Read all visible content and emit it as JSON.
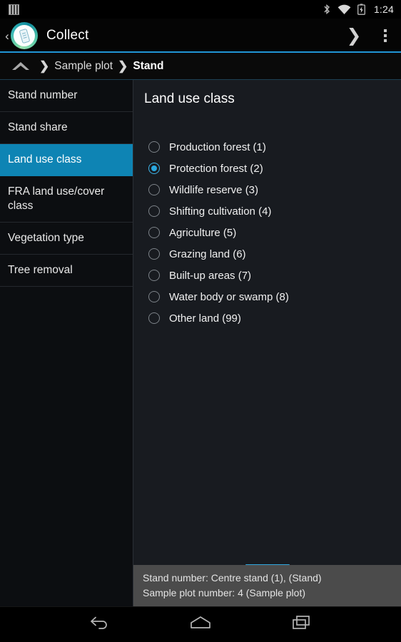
{
  "status_bar": {
    "sim_icon": "sim-card-icon",
    "bluetooth_icon": "bluetooth-icon",
    "wifi_icon": "wifi-icon",
    "battery_icon": "battery-charging-icon",
    "clock": "1:24"
  },
  "app_bar": {
    "up_caret": "‹",
    "logo_icon": "collect-mobile-logo",
    "title": "Collect",
    "next_icon": "chevron-right-icon",
    "overflow_icon": "overflow-menu-icon"
  },
  "breadcrumb": {
    "home_icon": "home-icon",
    "separator": "❯",
    "items": [
      {
        "label": "Sample plot",
        "current": false
      },
      {
        "label": "Stand",
        "current": true
      }
    ]
  },
  "sidebar": {
    "items": [
      {
        "label": "Stand number",
        "selected": false
      },
      {
        "label": "Stand share",
        "selected": false
      },
      {
        "label": "Land use class",
        "selected": true
      },
      {
        "label": "FRA land use/cover class",
        "selected": false
      },
      {
        "label": "Vegetation type",
        "selected": false
      },
      {
        "label": "Tree removal",
        "selected": false
      }
    ]
  },
  "content": {
    "title": "Land use class",
    "options": [
      {
        "label": "Production forest (1)",
        "selected": false
      },
      {
        "label": "Protection forest (2)",
        "selected": true
      },
      {
        "label": "Wildlife reserve (3)",
        "selected": false
      },
      {
        "label": "Shifting cultivation (4)",
        "selected": false
      },
      {
        "label": "Agriculture (5)",
        "selected": false
      },
      {
        "label": "Grazing land (6)",
        "selected": false
      },
      {
        "label": "Built-up areas (7)",
        "selected": false
      },
      {
        "label": "Water body or swamp (8)",
        "selected": false
      },
      {
        "label": "Other land (99)",
        "selected": false
      }
    ]
  },
  "info_panel": {
    "handle_icon": "drag-handle",
    "lines": [
      "Stand number: Centre stand (1),  (Stand)",
      "Sample plot number: 4 (Sample plot)"
    ]
  },
  "nav_bar": {
    "back_icon": "back-arrow-icon",
    "home_icon": "home-icon",
    "recents_icon": "recent-apps-icon"
  },
  "colors": {
    "accent": "#2196d6",
    "sidebar_selected": "#0e84b4",
    "radio_selected": "#29a8e0",
    "info_panel_bg": "#4b4b4b",
    "content_bg": "#181b20"
  }
}
